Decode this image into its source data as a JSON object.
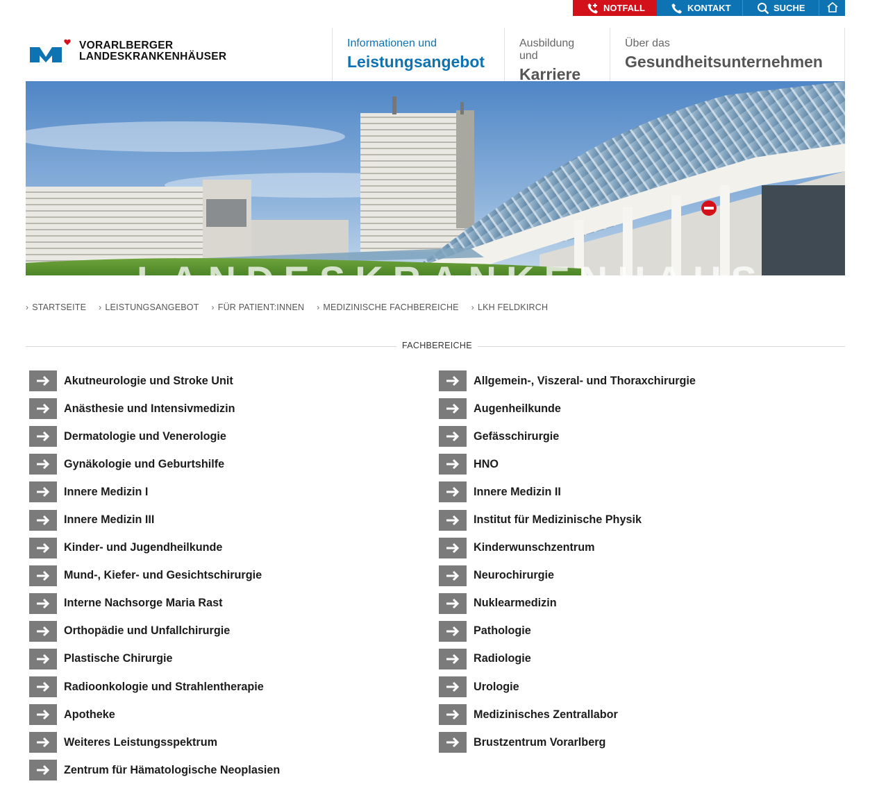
{
  "utility": {
    "notfall": "NOTFALL",
    "kontakt": "KONTAKT",
    "suche": "SUCHE"
  },
  "logo": {
    "line1": "VORARLBERGER",
    "line2": "LANDESKRANKENHÄUSER"
  },
  "nav": [
    {
      "top": "Informationen und",
      "main": "Leistungsangebot"
    },
    {
      "top": "Ausbildung und",
      "main": "Karriere"
    },
    {
      "top": "Über das",
      "main": "Gesundheitsunternehmen"
    }
  ],
  "breadcrumb": [
    "STARTSEITE",
    "LEISTUNGSANGEBOT",
    "FÜR PATIENT:INNEN",
    "MEDIZINISCHE FACHBEREICHE",
    "LKH FELDKIRCH"
  ],
  "section": {
    "title": "FACHBEREICHE"
  },
  "left_items": [
    "Akutneurologie und Stroke Unit",
    "Anästhesie und Intensivmedizin",
    "Dermatologie und Venerologie",
    "Gynäkologie und Geburtshilfe",
    "Innere Medizin I",
    "Innere Medizin III",
    "Kinder- und Jugendheilkunde",
    "Mund-, Kiefer- und Gesichtschirurgie",
    "Interne Nachsorge Maria Rast",
    "Orthopädie und Unfallchirurgie",
    "Plastische Chirurgie",
    "Radioonkologie und Strahlentherapie",
    "Apotheke",
    "Weiteres Leistungsspektrum",
    "Zentrum für Hämatologische Neoplasien"
  ],
  "right_items": [
    "Allgemein-, Viszeral- und Thoraxchirurgie",
    "Augenheilkunde",
    "Gefässchirurgie",
    "HNO",
    "Innere Medizin II",
    "Institut für Medizinische Physik",
    "Kinderwunschzentrum",
    "Neurochirurgie",
    "Nuklearmedizin",
    "Pathologie",
    "Radiologie",
    "Urologie",
    "Medizinisches Zentrallabor",
    "Brustzentrum Vorarlberg"
  ]
}
